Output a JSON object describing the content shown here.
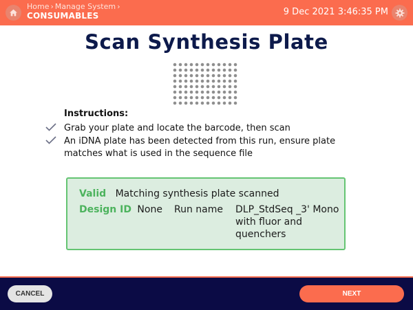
{
  "header": {
    "breadcrumb_home": "Home",
    "breadcrumb_manage": "Manage System",
    "current_section": "CONSUMABLES",
    "datetime": "9 Dec 2021 3:46:35 PM",
    "home_icon": "home-icon",
    "settings_icon": "gear-icon"
  },
  "page": {
    "title": "Scan Synthesis Plate",
    "plate_icon": "well-plate-icon"
  },
  "instructions": {
    "heading": "Instructions:",
    "items": [
      "Grab your plate and locate the barcode, then scan",
      "An iDNA plate has been detected from this run, ensure plate matches what is used in the sequence file"
    ]
  },
  "status": {
    "valid_label": "Valid",
    "valid_text": "Matching synthesis plate scanned",
    "design_id_label": "Design ID",
    "design_id_value": "None",
    "run_name_label": "Run name",
    "run_name_value": "DLP_StdSeq _3' Mono with fluor and quenchers"
  },
  "footer": {
    "cancel_label": "CANCEL",
    "next_label": "NEXT"
  },
  "colors": {
    "header": "#fb6c4e",
    "footer": "#0b0b45",
    "title": "#0d1a4b",
    "valid_green": "#4cb35d",
    "status_bg": "#dcede0"
  }
}
